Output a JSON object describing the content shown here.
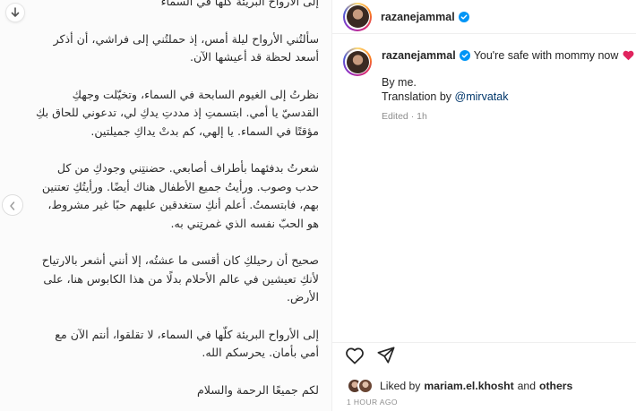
{
  "post_image": {
    "paragraphs": [
      "إلى الأرواح البريئة كلها في السماء",
      "سألتُني الأرواح ليلة أمس، إذ حملتُني إلى فراشي، أن أذكر أسعد لحظة قد أعيشها الآن.",
      "نظرتُ إلى الغيوم السابحة في السماء، وتخيّلت وجهكِ القدسيّ يا أمي. ابتسمتِ إذ مددتِ يدكِ لي، تدعوني للحاق بكِ مؤقتًا في السماء. يا إلهي، كم بدتْ يداكِ جميلتين.",
      "شعرتُ بدفئهما بأطراف أصابعي. حضنتِني وجودكِ من كل حدب وصوب. ورأيتُ جميع الأطفال هناك أيضًا. ورأيتُكِ تعتنين بهم، فابتسمتُ. أعلم أنكِ ستغدقين عليهم حبًا غير مشروط، هو الحبّ نفسه الذي غمرتِني به.",
      "صحيح أن رحيلكِ كان أقسى ما عشتُه، إلا أنني أشعر بالارتياح لأنكِ تعيشين في عالم الأحلام بدلًا من هذا الكابوس هنا، على الأرض.",
      "إلى الأرواح البريئة كلّها في السماء، لا تقلقوا، أنتم الآن مع أمي بأمان. يحرسكم الله.",
      "لكم جميعًا الرحمة والسلام"
    ]
  },
  "header": {
    "username": "razanejammal"
  },
  "caption": {
    "username": "razanejammal",
    "text": "You're safe with mommy now",
    "by_line": "By me.",
    "translation_prefix": "Translation by ",
    "translation_mention": "@mirvatak",
    "edited": "Edited",
    "separator": "·",
    "time": "1h"
  },
  "likes": {
    "prefix": "Liked by",
    "user": "mariam.el.khosht",
    "joiner": "and",
    "others": "others"
  },
  "timestamp": "1 HOUR AGO",
  "icons": {
    "scroll": "arrow-down-icon",
    "prev": "chevron-left-icon",
    "verified": "verified-badge-icon",
    "heart": "red-heart-icon",
    "bandage": "bandage-icon",
    "like": "heart-outline-icon",
    "share": "paper-plane-icon"
  },
  "colors": {
    "verified_blue": "#0095f6",
    "mention": "#00376b",
    "heart_red": "#e0245e"
  }
}
